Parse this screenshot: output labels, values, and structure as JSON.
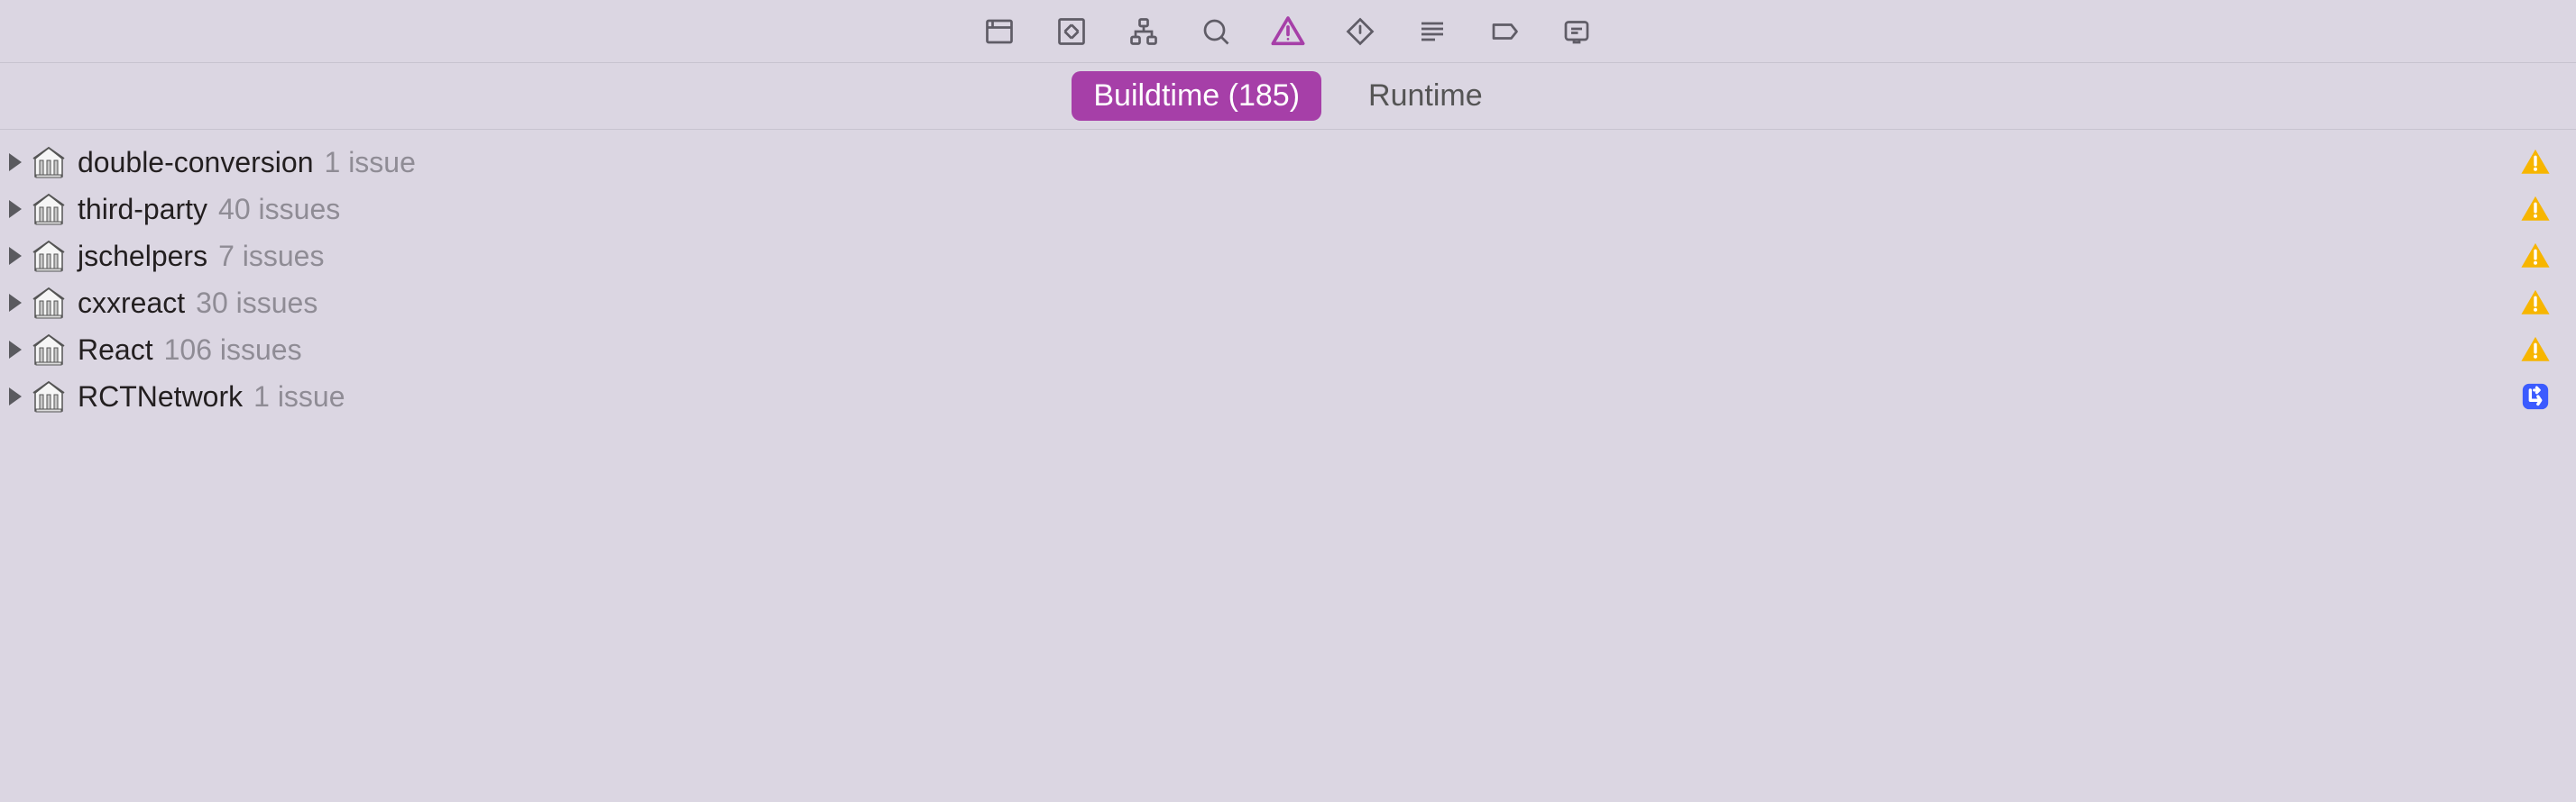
{
  "tabs": {
    "buildtime_label": "Buildtime (185)",
    "runtime_label": "Runtime"
  },
  "issues": [
    {
      "name": "double-conversion",
      "count_text": "1 issue",
      "status": "warning"
    },
    {
      "name": "third-party",
      "count_text": "40 issues",
      "status": "warning"
    },
    {
      "name": "jschelpers",
      "count_text": "7 issues",
      "status": "warning"
    },
    {
      "name": "cxxreact",
      "count_text": "30 issues",
      "status": "warning"
    },
    {
      "name": "React",
      "count_text": "106 issues",
      "status": "warning"
    },
    {
      "name": "RCTNetwork",
      "count_text": "1 issue",
      "status": "info"
    }
  ]
}
